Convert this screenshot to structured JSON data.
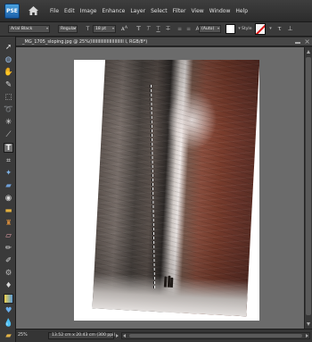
{
  "app": {
    "logo_text": "PSE",
    "menu": [
      "File",
      "Edit",
      "Image",
      "Enhance",
      "Layer",
      "Select",
      "Filter",
      "View",
      "Window",
      "Help"
    ]
  },
  "options_bar": {
    "font_family": "Arial Black",
    "font_style": "Regular",
    "font_size": "18 pt",
    "leading": "(Auto)",
    "style_label": "Style",
    "text_color": "#ffffff"
  },
  "document": {
    "title": "_MG_1705_sloping.jpg @ 25%(IIIIIIIIIIIIIIIIIIIIIIIII I, RGB/8*)"
  },
  "status_bar": {
    "zoom": "25%",
    "doc_info": "13.52 cm x 20.43 cm (300 ppi)"
  },
  "toolbox": {
    "active_tool": "type-tool",
    "tools": [
      "move-tool",
      "zoom-tool",
      "hand-tool",
      "eyedropper-tool",
      "rectangular-marquee-tool",
      "lasso-tool",
      "magic-wand-tool",
      "quick-selection-tool",
      "type-tool",
      "crop-tool",
      "cookie-cutter-tool",
      "straighten-tool",
      "red-eye-tool",
      "spot-healing-tool",
      "clone-stamp-tool",
      "eraser-tool",
      "pencil-tool",
      "brush-tool",
      "smart-brush-tool",
      "paint-bucket-tool",
      "gradient-tool",
      "custom-shape-tool",
      "blur-tool",
      "sponge-tool",
      "foreground-background-colors"
    ]
  },
  "colors": {
    "chrome_dark": "#2b2b2b",
    "canvas_gray": "#6b6b6b",
    "logo_blue": "#1b5fa6",
    "no_style_red": "#dd1111"
  }
}
